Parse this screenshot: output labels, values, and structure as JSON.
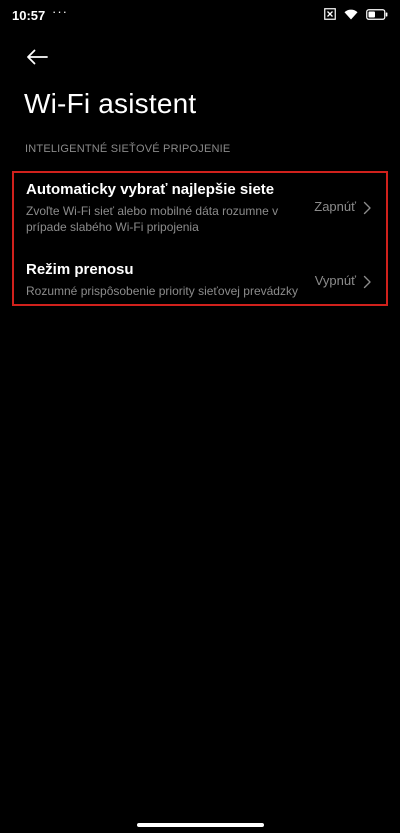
{
  "status_bar": {
    "time": "10:57",
    "dots": "···",
    "icons": [
      "close-box-icon",
      "wifi-icon",
      "battery-icon"
    ]
  },
  "header": {
    "back_icon": "arrow-left-icon",
    "title": "Wi-Fi asistent"
  },
  "section": {
    "label": "INTELIGENTNÉ SIEŤOVÉ PRIPOJENIE"
  },
  "rows": [
    {
      "title": "Automaticky vybrať najlepšie siete",
      "description": "Zvoľte Wi-Fi sieť alebo mobilné dáta rozumne v prípade slabého Wi-Fi pripojenia",
      "value": "Zapnúť"
    },
    {
      "title": "Režim prenosu",
      "description": "Rozumné prispôsobenie priority sieťovej prevádzky",
      "value": "Vypnúť"
    }
  ],
  "colors": {
    "background": "#000000",
    "text_primary": "#ffffff",
    "text_secondary": "#8c8c8c",
    "highlight_border": "#d0211c"
  }
}
